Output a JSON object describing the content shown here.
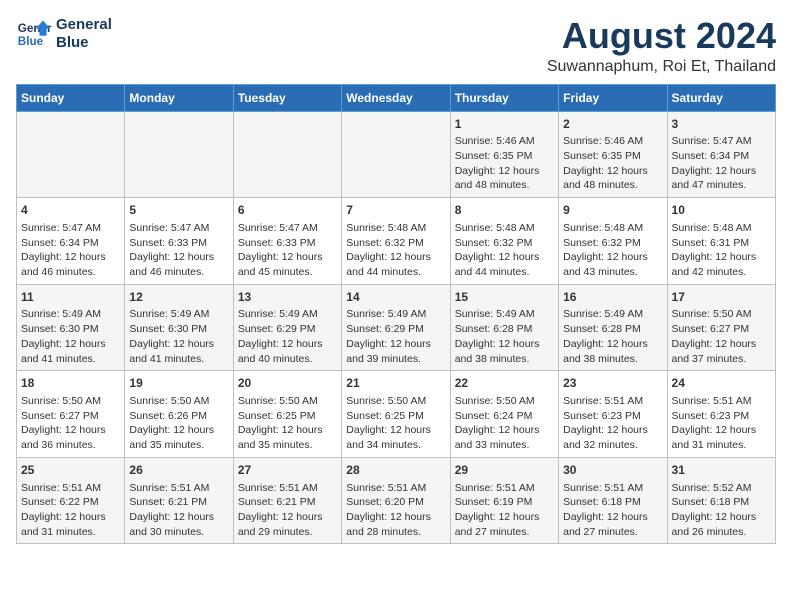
{
  "header": {
    "logo_line1": "General",
    "logo_line2": "Blue",
    "title": "August 2024",
    "subtitle": "Suwannaphum, Roi Et, Thailand"
  },
  "weekdays": [
    "Sunday",
    "Monday",
    "Tuesday",
    "Wednesday",
    "Thursday",
    "Friday",
    "Saturday"
  ],
  "weeks": [
    [
      {
        "day": "",
        "content": ""
      },
      {
        "day": "",
        "content": ""
      },
      {
        "day": "",
        "content": ""
      },
      {
        "day": "",
        "content": ""
      },
      {
        "day": "1",
        "content": "Sunrise: 5:46 AM\nSunset: 6:35 PM\nDaylight: 12 hours\nand 48 minutes."
      },
      {
        "day": "2",
        "content": "Sunrise: 5:46 AM\nSunset: 6:35 PM\nDaylight: 12 hours\nand 48 minutes."
      },
      {
        "day": "3",
        "content": "Sunrise: 5:47 AM\nSunset: 6:34 PM\nDaylight: 12 hours\nand 47 minutes."
      }
    ],
    [
      {
        "day": "4",
        "content": "Sunrise: 5:47 AM\nSunset: 6:34 PM\nDaylight: 12 hours\nand 46 minutes."
      },
      {
        "day": "5",
        "content": "Sunrise: 5:47 AM\nSunset: 6:33 PM\nDaylight: 12 hours\nand 46 minutes."
      },
      {
        "day": "6",
        "content": "Sunrise: 5:47 AM\nSunset: 6:33 PM\nDaylight: 12 hours\nand 45 minutes."
      },
      {
        "day": "7",
        "content": "Sunrise: 5:48 AM\nSunset: 6:32 PM\nDaylight: 12 hours\nand 44 minutes."
      },
      {
        "day": "8",
        "content": "Sunrise: 5:48 AM\nSunset: 6:32 PM\nDaylight: 12 hours\nand 44 minutes."
      },
      {
        "day": "9",
        "content": "Sunrise: 5:48 AM\nSunset: 6:32 PM\nDaylight: 12 hours\nand 43 minutes."
      },
      {
        "day": "10",
        "content": "Sunrise: 5:48 AM\nSunset: 6:31 PM\nDaylight: 12 hours\nand 42 minutes."
      }
    ],
    [
      {
        "day": "11",
        "content": "Sunrise: 5:49 AM\nSunset: 6:30 PM\nDaylight: 12 hours\nand 41 minutes."
      },
      {
        "day": "12",
        "content": "Sunrise: 5:49 AM\nSunset: 6:30 PM\nDaylight: 12 hours\nand 41 minutes."
      },
      {
        "day": "13",
        "content": "Sunrise: 5:49 AM\nSunset: 6:29 PM\nDaylight: 12 hours\nand 40 minutes."
      },
      {
        "day": "14",
        "content": "Sunrise: 5:49 AM\nSunset: 6:29 PM\nDaylight: 12 hours\nand 39 minutes."
      },
      {
        "day": "15",
        "content": "Sunrise: 5:49 AM\nSunset: 6:28 PM\nDaylight: 12 hours\nand 38 minutes."
      },
      {
        "day": "16",
        "content": "Sunrise: 5:49 AM\nSunset: 6:28 PM\nDaylight: 12 hours\nand 38 minutes."
      },
      {
        "day": "17",
        "content": "Sunrise: 5:50 AM\nSunset: 6:27 PM\nDaylight: 12 hours\nand 37 minutes."
      }
    ],
    [
      {
        "day": "18",
        "content": "Sunrise: 5:50 AM\nSunset: 6:27 PM\nDaylight: 12 hours\nand 36 minutes."
      },
      {
        "day": "19",
        "content": "Sunrise: 5:50 AM\nSunset: 6:26 PM\nDaylight: 12 hours\nand 35 minutes."
      },
      {
        "day": "20",
        "content": "Sunrise: 5:50 AM\nSunset: 6:25 PM\nDaylight: 12 hours\nand 35 minutes."
      },
      {
        "day": "21",
        "content": "Sunrise: 5:50 AM\nSunset: 6:25 PM\nDaylight: 12 hours\nand 34 minutes."
      },
      {
        "day": "22",
        "content": "Sunrise: 5:50 AM\nSunset: 6:24 PM\nDaylight: 12 hours\nand 33 minutes."
      },
      {
        "day": "23",
        "content": "Sunrise: 5:51 AM\nSunset: 6:23 PM\nDaylight: 12 hours\nand 32 minutes."
      },
      {
        "day": "24",
        "content": "Sunrise: 5:51 AM\nSunset: 6:23 PM\nDaylight: 12 hours\nand 31 minutes."
      }
    ],
    [
      {
        "day": "25",
        "content": "Sunrise: 5:51 AM\nSunset: 6:22 PM\nDaylight: 12 hours\nand 31 minutes."
      },
      {
        "day": "26",
        "content": "Sunrise: 5:51 AM\nSunset: 6:21 PM\nDaylight: 12 hours\nand 30 minutes."
      },
      {
        "day": "27",
        "content": "Sunrise: 5:51 AM\nSunset: 6:21 PM\nDaylight: 12 hours\nand 29 minutes."
      },
      {
        "day": "28",
        "content": "Sunrise: 5:51 AM\nSunset: 6:20 PM\nDaylight: 12 hours\nand 28 minutes."
      },
      {
        "day": "29",
        "content": "Sunrise: 5:51 AM\nSunset: 6:19 PM\nDaylight: 12 hours\nand 27 minutes."
      },
      {
        "day": "30",
        "content": "Sunrise: 5:51 AM\nSunset: 6:18 PM\nDaylight: 12 hours\nand 27 minutes."
      },
      {
        "day": "31",
        "content": "Sunrise: 5:52 AM\nSunset: 6:18 PM\nDaylight: 12 hours\nand 26 minutes."
      }
    ]
  ]
}
